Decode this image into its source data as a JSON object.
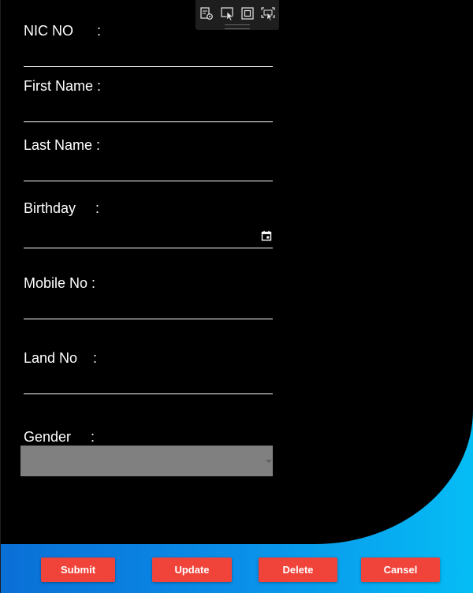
{
  "colors": {
    "form_background": "#000000",
    "accent_gradient_start": "#0a6fd6",
    "accent_gradient_end": "#05bdf5",
    "button": "#f0443b",
    "select_background": "#808080",
    "text": "#ffffff"
  },
  "toolbar": {
    "icons": [
      "live-visual-tree-icon",
      "select-element-icon",
      "display-layout-adorners-icon",
      "track-focused-element-icon"
    ]
  },
  "form": {
    "nic": {
      "label": "NIC NO      :",
      "value": ""
    },
    "first_name": {
      "label": "First Name :",
      "value": ""
    },
    "last_name": {
      "label": "Last Name :",
      "value": ""
    },
    "birthday": {
      "label": "Birthday     :",
      "value": "",
      "icon": "calendar-icon"
    },
    "mobile": {
      "label": "Mobile No :",
      "value": ""
    },
    "land": {
      "label": "Land No    :",
      "value": ""
    },
    "gender": {
      "label": "Gender     :",
      "selected": ""
    }
  },
  "buttons": {
    "submit": "Submit",
    "update": "Update",
    "delete": "Delete",
    "cancel": "Cansel"
  }
}
